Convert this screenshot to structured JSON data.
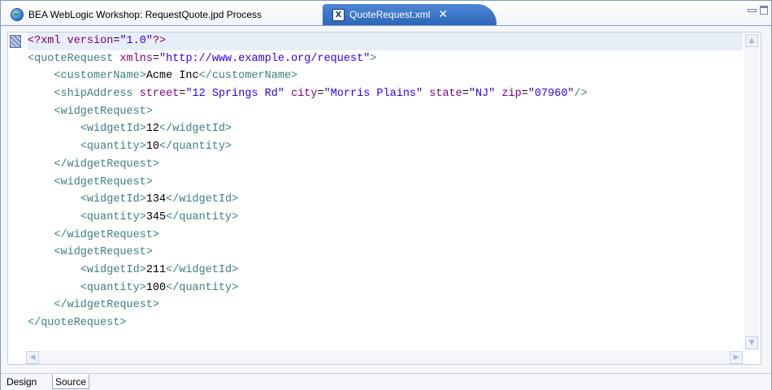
{
  "tabs": [
    {
      "label": "BEA WebLogic Workshop: RequestQuote.jpd Process",
      "active": false
    },
    {
      "label": "QuoteRequest.xml",
      "active": true,
      "icon_letter": "X"
    }
  ],
  "icons": {
    "tab1": "globe-icon",
    "tab2": "xml-file-icon",
    "close": "close-icon"
  },
  "close_glyph": "✕",
  "window_controls": [
    "minimize",
    "maximize"
  ],
  "scroll_glyphs": {
    "up": "▲",
    "down": "▼",
    "left": "◀",
    "right": "▶"
  },
  "editor": {
    "lines": [
      [
        {
          "t": "pi",
          "v": "<?xml "
        },
        {
          "t": "attr",
          "v": "version"
        },
        {
          "t": "text",
          "v": "="
        },
        {
          "t": "val",
          "v": "\"1.0\""
        },
        {
          "t": "pi",
          "v": "?>"
        }
      ],
      [
        {
          "t": "tag",
          "v": "<quoteRequest "
        },
        {
          "t": "attr",
          "v": "xmlns"
        },
        {
          "t": "text",
          "v": "="
        },
        {
          "t": "val",
          "v": "\"http://www.example.org/request\""
        },
        {
          "t": "tag",
          "v": ">"
        }
      ],
      [
        {
          "t": "text",
          "v": "    "
        },
        {
          "t": "tag",
          "v": "<customerName>"
        },
        {
          "t": "text",
          "v": "Acme Inc"
        },
        {
          "t": "tag",
          "v": "</customerName>"
        }
      ],
      [
        {
          "t": "text",
          "v": "    "
        },
        {
          "t": "tag",
          "v": "<shipAddress "
        },
        {
          "t": "attr",
          "v": "street"
        },
        {
          "t": "text",
          "v": "="
        },
        {
          "t": "val",
          "v": "\"12 Springs Rd\""
        },
        {
          "t": "text",
          "v": " "
        },
        {
          "t": "attr",
          "v": "city"
        },
        {
          "t": "text",
          "v": "="
        },
        {
          "t": "val",
          "v": "\"Morris Plains\""
        },
        {
          "t": "text",
          "v": " "
        },
        {
          "t": "attr",
          "v": "state"
        },
        {
          "t": "text",
          "v": "="
        },
        {
          "t": "val",
          "v": "\"NJ\""
        },
        {
          "t": "text",
          "v": " "
        },
        {
          "t": "attr",
          "v": "zip"
        },
        {
          "t": "text",
          "v": "="
        },
        {
          "t": "val",
          "v": "\"07960\""
        },
        {
          "t": "tag",
          "v": "/>"
        }
      ],
      [
        {
          "t": "text",
          "v": "    "
        },
        {
          "t": "tag",
          "v": "<widgetRequest>"
        }
      ],
      [
        {
          "t": "text",
          "v": "        "
        },
        {
          "t": "tag",
          "v": "<widgetId>"
        },
        {
          "t": "text",
          "v": "12"
        },
        {
          "t": "tag",
          "v": "</widgetId>"
        }
      ],
      [
        {
          "t": "text",
          "v": "        "
        },
        {
          "t": "tag",
          "v": "<quantity>"
        },
        {
          "t": "text",
          "v": "10"
        },
        {
          "t": "tag",
          "v": "</quantity>"
        }
      ],
      [
        {
          "t": "text",
          "v": "    "
        },
        {
          "t": "tag",
          "v": "</widgetRequest>"
        }
      ],
      [
        {
          "t": "text",
          "v": "    "
        },
        {
          "t": "tag",
          "v": "<widgetRequest>"
        }
      ],
      [
        {
          "t": "text",
          "v": "        "
        },
        {
          "t": "tag",
          "v": "<widgetId>"
        },
        {
          "t": "text",
          "v": "134"
        },
        {
          "t": "tag",
          "v": "</widgetId>"
        }
      ],
      [
        {
          "t": "text",
          "v": "        "
        },
        {
          "t": "tag",
          "v": "<quantity>"
        },
        {
          "t": "text",
          "v": "345"
        },
        {
          "t": "tag",
          "v": "</quantity>"
        }
      ],
      [
        {
          "t": "text",
          "v": "    "
        },
        {
          "t": "tag",
          "v": "</widgetRequest>"
        }
      ],
      [
        {
          "t": "text",
          "v": "    "
        },
        {
          "t": "tag",
          "v": "<widgetRequest>"
        }
      ],
      [
        {
          "t": "text",
          "v": "        "
        },
        {
          "t": "tag",
          "v": "<widgetId>"
        },
        {
          "t": "text",
          "v": "211"
        },
        {
          "t": "tag",
          "v": "</widgetId>"
        }
      ],
      [
        {
          "t": "text",
          "v": "        "
        },
        {
          "t": "tag",
          "v": "<quantity>"
        },
        {
          "t": "text",
          "v": "100"
        },
        {
          "t": "tag",
          "v": "</quantity>"
        }
      ],
      [
        {
          "t": "text",
          "v": "    "
        },
        {
          "t": "tag",
          "v": "</widgetRequest>"
        }
      ],
      [
        {
          "t": "tag",
          "v": "</quoteRequest>"
        }
      ]
    ]
  },
  "bottom_tabs": [
    {
      "label": "Design",
      "active": false
    },
    {
      "label": "Source",
      "active": true
    }
  ],
  "colors": {
    "tag": "#3f8080",
    "attribute": "#7f007f",
    "value": "#2a00ff",
    "processing_instruction": "#7f0055",
    "active_tab": "#2f65b8"
  }
}
